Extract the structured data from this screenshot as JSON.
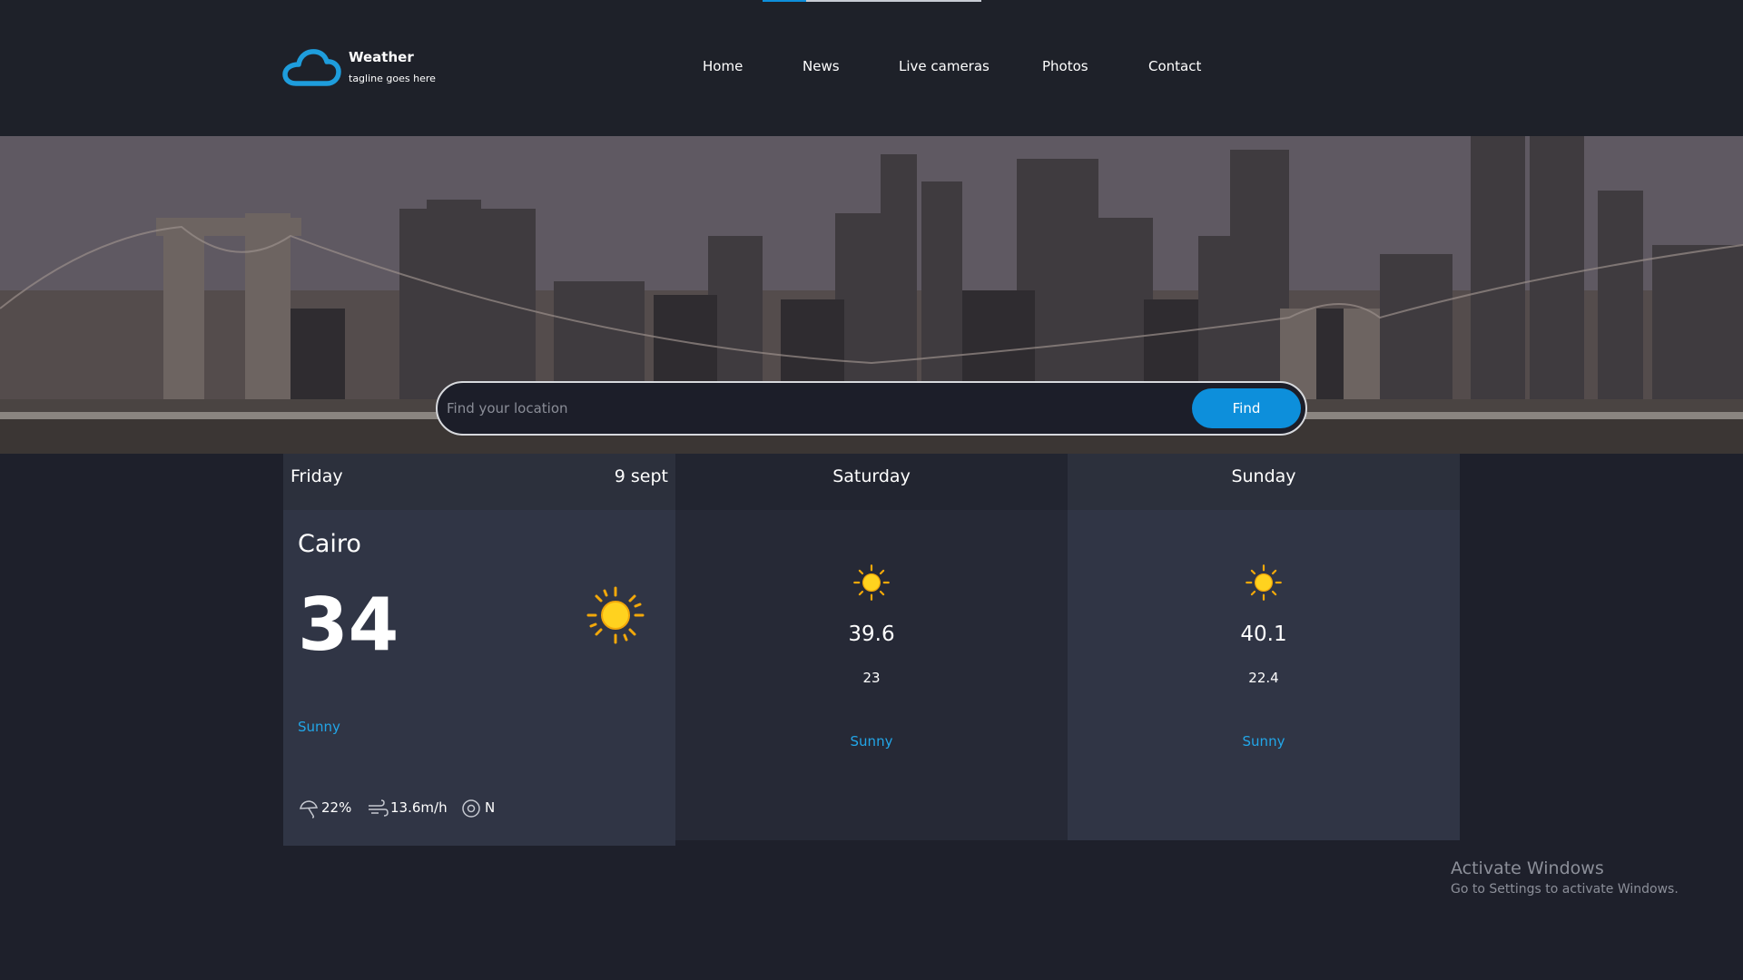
{
  "brand": {
    "title": "Weather",
    "tagline": "tagline goes here",
    "logo_icon": "cloud-icon",
    "accent_color": "#0d8fdb"
  },
  "nav": {
    "items": [
      "Home",
      "News",
      "Live cameras",
      "Photos",
      "Contact"
    ]
  },
  "search": {
    "placeholder": "Find your location",
    "value": "",
    "button_label": "Find",
    "button_color": "#0d8fdb"
  },
  "forecast": {
    "today": {
      "day": "Friday",
      "date": "9 sept",
      "city": "Cairo",
      "temp": "34",
      "condition": "Sunny",
      "icon": "sun-icon",
      "humidity": "22%",
      "wind_speed": "13.6m/h",
      "wind_direction": "N"
    },
    "next_days": [
      {
        "day": "Saturday",
        "max": "39.6",
        "min": "23",
        "condition": "Sunny",
        "icon": "sun-icon"
      },
      {
        "day": "Sunday",
        "max": "40.1",
        "min": "22.4",
        "condition": "Sunny",
        "icon": "sun-icon"
      }
    ],
    "condition_color": "#22a6e8"
  },
  "watermark": {
    "title": "Activate Windows",
    "subtitle": "Go to Settings to activate Windows."
  }
}
